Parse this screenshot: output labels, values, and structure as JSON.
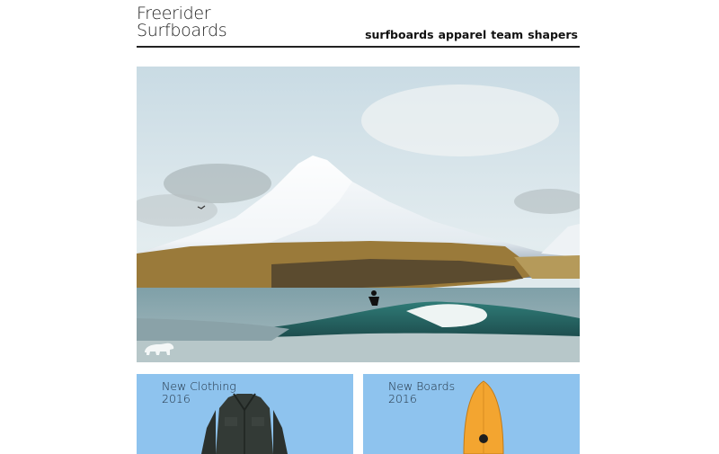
{
  "brand": {
    "line1": "Freerider",
    "line2": "Surfboards"
  },
  "nav": {
    "items": [
      "surfboards",
      "apparel",
      "team",
      "shapers"
    ]
  },
  "hero": {
    "alt_icon": "polar-bear-icon"
  },
  "cards": [
    {
      "title": "New Clothing",
      "year": "2016",
      "image": "jacket-image"
    },
    {
      "title": "New Boards",
      "year": "2016",
      "image": "surfboard-image"
    }
  ],
  "colors": {
    "card_bg": "#8ec3ee",
    "text": "#222222",
    "rule": "#222222"
  }
}
